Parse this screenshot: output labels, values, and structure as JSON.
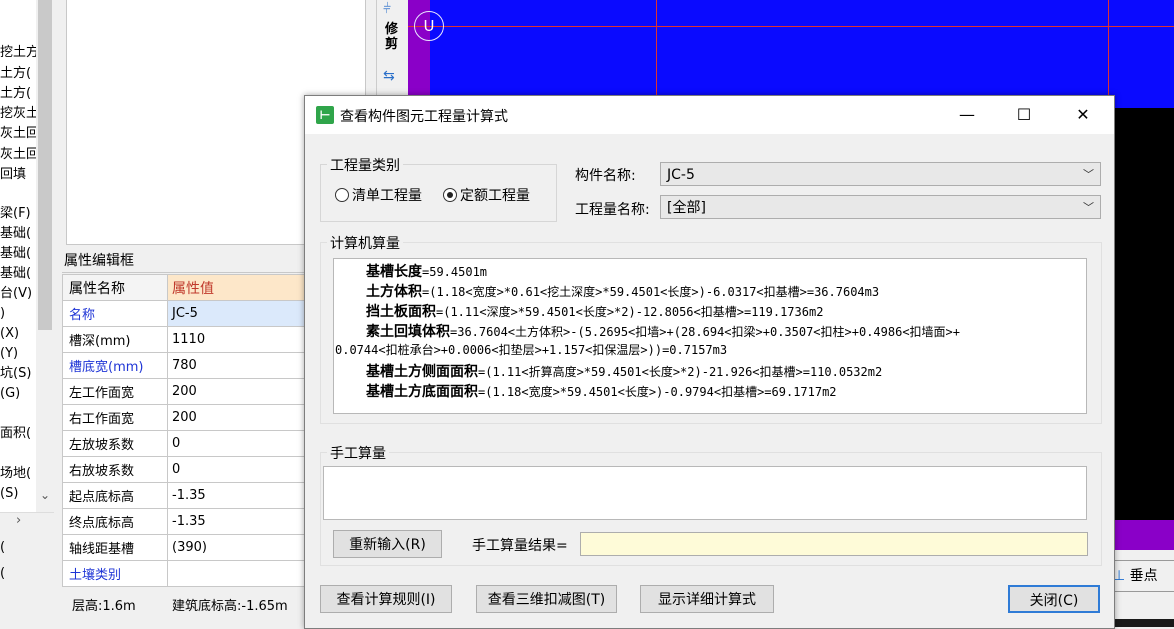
{
  "left_tree": {
    "items": [
      "挖土方",
      "土方(",
      "土方(",
      "挖灰土",
      "灰土回",
      "灰土回",
      "回填",
      "梁(F)",
      "基础(",
      "基础(",
      "基础(",
      "台(V)",
      ")",
      "(X)",
      "(Y)",
      "坑(S)",
      "(G)",
      "面积(",
      "场地(",
      "(S)"
    ],
    "bottom_items": [
      "(",
      "("
    ]
  },
  "property_panel": {
    "title": "属性编辑框",
    "headers": {
      "name": "属性名称",
      "value": "属性值"
    },
    "rows": [
      {
        "name": "名称",
        "value": "JC-5"
      },
      {
        "name": "槽深(mm)",
        "value": "1110"
      },
      {
        "name": "槽底宽(mm)",
        "value": "780"
      },
      {
        "name": "左工作面宽",
        "value": "200"
      },
      {
        "name": "右工作面宽",
        "value": "200"
      },
      {
        "name": "左放坡系数",
        "value": "0"
      },
      {
        "name": "右放坡系数",
        "value": "0"
      },
      {
        "name": "起点底标高",
        "value": "-1.35"
      },
      {
        "name": "终点底标高",
        "value": "-1.35"
      },
      {
        "name": "轴线距基槽",
        "value": "(390)"
      },
      {
        "name": "土壤类别",
        "value": ""
      }
    ]
  },
  "status_bar": {
    "floor_height": "层高:1.6m",
    "building_bottom": "建筑底标高:-1.65m"
  },
  "tool_strip": {
    "trim_label_1": "修",
    "trim_label_2": "剪"
  },
  "canvas": {
    "axis_marker": "U",
    "snap_button": "垂点"
  },
  "dialog": {
    "title": "查看构件图元工程量计算式",
    "window_buttons": {
      "minimize": "—",
      "maximize": "☐",
      "close": "✕"
    },
    "qty_category": {
      "legend": "工程量类别",
      "options": [
        {
          "label": "清单工程量",
          "selected": false
        },
        {
          "label": "定额工程量",
          "selected": true
        }
      ]
    },
    "component_name": {
      "label": "构件名称:",
      "value": "JC-5"
    },
    "quantity_name": {
      "label": "工程量名称:",
      "value": "[全部]"
    },
    "computer_calc": {
      "legend": "计算机算量",
      "lines": [
        {
          "name": "基槽长度",
          "expr": "=59.4501m"
        },
        {
          "name": "土方体积",
          "expr": "=(1.18<宽度>*0.61<挖土深度>*59.4501<长度>)-6.0317<扣基槽>=36.7604m3"
        },
        {
          "name": "挡土板面积",
          "expr": "=(1.11<深度>*59.4501<长度>*2)-12.8056<扣基槽>=119.1736m2"
        },
        {
          "name": "素土回填体积",
          "expr": "=36.7604<土方体积>-(5.2695<扣墙>+(28.694<扣梁>+0.3507<扣柱>+0.4986<扣墙面>+"
        },
        {
          "name": "",
          "expr": "0.0744<扣桩承台>+0.0006<扣垫层>+1.157<扣保温层>))=0.7157m3"
        },
        {
          "name": "基槽土方侧面面积",
          "expr": "=(1.11<折算高度>*59.4501<长度>*2)-21.926<扣基槽>=110.0532m2"
        },
        {
          "name": "基槽土方底面面积",
          "expr": "=(1.18<宽度>*59.4501<长度>)-0.9794<扣基槽>=69.1717m2"
        }
      ]
    },
    "manual_calc": {
      "legend": "手工算量",
      "reenter_button": "重新输入(R)",
      "result_label": "手工算量结果=",
      "result_value": ""
    },
    "buttons": {
      "view_rules": "查看计算规则(I)",
      "view_3d": "查看三维扣减图(T)",
      "show_detail": "显示详细计算式",
      "close": "关闭(C)"
    }
  }
}
